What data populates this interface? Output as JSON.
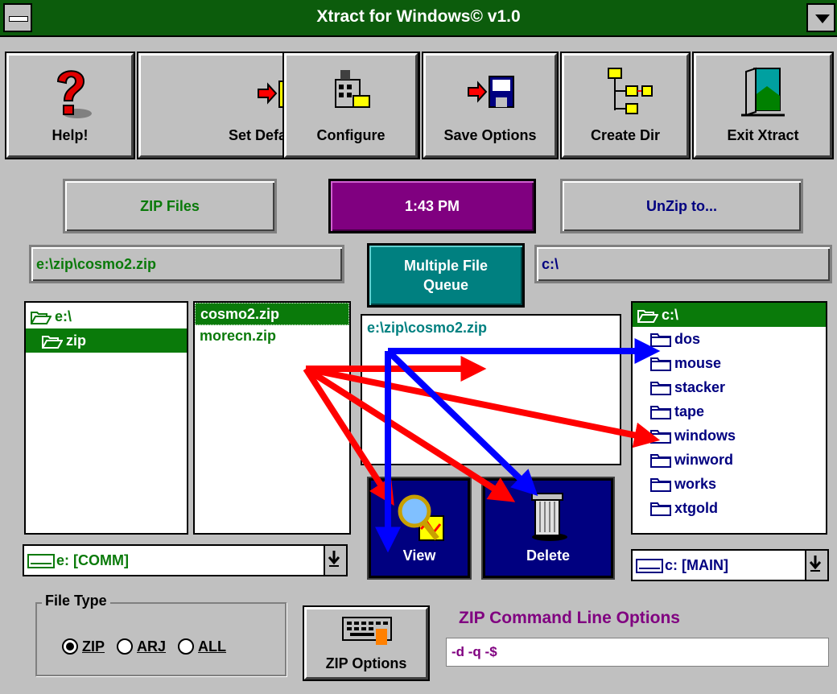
{
  "window": {
    "title": "Xtract for Windows© v1.0"
  },
  "toolbar": {
    "help": "Help!",
    "set_default_dir": "Set Default Dir",
    "configure": "Configure",
    "save_options": "Save Options",
    "create_dir": "Create Dir",
    "exit": "Exit Xtract"
  },
  "status": {
    "zip_files_label": "ZIP Files",
    "clock": "1:43 PM",
    "unzip_to_label": "UnZip to..."
  },
  "paths": {
    "source_zip": "e:\\zip\\cosmo2.zip",
    "target_dir": "c:\\"
  },
  "queue": {
    "button_label": "Multiple File Queue",
    "items": [
      "e:\\zip\\cosmo2.zip"
    ]
  },
  "source_dirs": [
    {
      "label": "e:\\",
      "selected": false,
      "icon": "folder-open-icon"
    },
    {
      "label": "zip",
      "selected": true,
      "icon": "folder-open-icon"
    }
  ],
  "zip_files": [
    {
      "label": "cosmo2.zip",
      "selected": true
    },
    {
      "label": "morecn.zip",
      "selected": false
    }
  ],
  "target_dirs": [
    {
      "label": "c:\\",
      "selected": true,
      "icon": "folder-open-icon"
    },
    {
      "label": "dos",
      "selected": false,
      "icon": "folder-icon"
    },
    {
      "label": "mouse",
      "selected": false,
      "icon": "folder-icon"
    },
    {
      "label": "stacker",
      "selected": false,
      "icon": "folder-icon"
    },
    {
      "label": "tape",
      "selected": false,
      "icon": "folder-icon"
    },
    {
      "label": "windows",
      "selected": false,
      "icon": "folder-icon"
    },
    {
      "label": "winword",
      "selected": false,
      "icon": "folder-icon"
    },
    {
      "label": "works",
      "selected": false,
      "icon": "folder-icon"
    },
    {
      "label": "xtgold",
      "selected": false,
      "icon": "folder-icon"
    }
  ],
  "actions": {
    "view": "View",
    "delete": "Delete"
  },
  "drives": {
    "source": "e: [COMM]",
    "target": "c: [MAIN]"
  },
  "file_type": {
    "group_label": "File Type",
    "options": [
      {
        "label": "ZIP",
        "checked": true
      },
      {
        "label": "ARJ",
        "checked": false
      },
      {
        "label": "ALL",
        "checked": false
      }
    ]
  },
  "zip_options": {
    "button_label": "ZIP Options",
    "command_line_label": "ZIP Command Line Options",
    "command_line_value": "-d -q -$"
  },
  "colors": {
    "title_bar": "#0c5c0c",
    "selection": "#0a7a0a",
    "clock_bg": "#800080",
    "queue_bg": "#008080",
    "action_bg": "#000080",
    "target_text": "#000080",
    "arrow_red": "#ff0000",
    "arrow_blue": "#0000ff"
  }
}
